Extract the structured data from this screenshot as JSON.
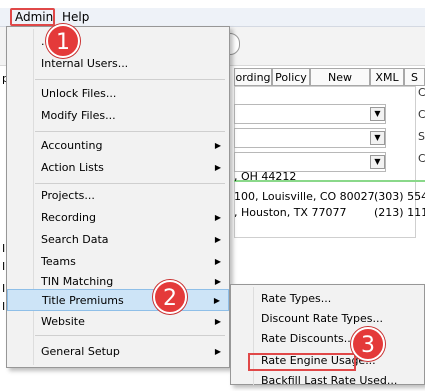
{
  "colors": {
    "callout": "#e43a3a",
    "highlight": "#cde4f7",
    "menu_bg": "#f2f2f2"
  },
  "menubar": {
    "admin": "Admin",
    "help": "Help"
  },
  "callouts": {
    "step1": "1",
    "step2": "2",
    "step3": "3"
  },
  "admin_menu": {
    "items": [
      {
        "label": "...s...",
        "submenu": false
      },
      {
        "label": "Internal Users...",
        "submenu": false
      },
      {
        "label": "Unlock Files...",
        "submenu": false
      },
      {
        "label": "Modify Files...",
        "submenu": false
      },
      {
        "label": "Accounting",
        "submenu": true
      },
      {
        "label": "Action Lists",
        "submenu": true
      },
      {
        "label": "Projects...",
        "submenu": false
      },
      {
        "label": "Recording",
        "submenu": true
      },
      {
        "label": "Search Data",
        "submenu": true
      },
      {
        "label": "Teams",
        "submenu": true
      },
      {
        "label": "TIN Matching",
        "submenu": true
      },
      {
        "label": "Title Premiums",
        "submenu": true
      },
      {
        "label": "Website",
        "submenu": true
      },
      {
        "label": "General Setup",
        "submenu": true
      }
    ]
  },
  "title_premiums_submenu": {
    "items": [
      {
        "label": "Rate Types..."
      },
      {
        "label": "Discount Rate Types..."
      },
      {
        "label": "Rate Discounts..."
      },
      {
        "label": "Rate Engine Usage..."
      },
      {
        "label": "Backfill Last Rate Used..."
      }
    ]
  },
  "background": {
    "tabs": [
      "ording",
      "Policy",
      "New Loans",
      "XML",
      "S"
    ],
    "right_labels": [
      "C",
      "C",
      "S",
      "C"
    ],
    "rows": [
      {
        "address": ", OH 44212",
        "phone": ""
      },
      {
        "address": "100, Louisville, CO 80027",
        "phone": "(303) 554-"
      },
      {
        "address": ", Houston, TX 77077",
        "phone": "(213) 111-"
      }
    ],
    "left_edge": [
      "p",
      "I",
      "I",
      "I",
      "I"
    ]
  }
}
